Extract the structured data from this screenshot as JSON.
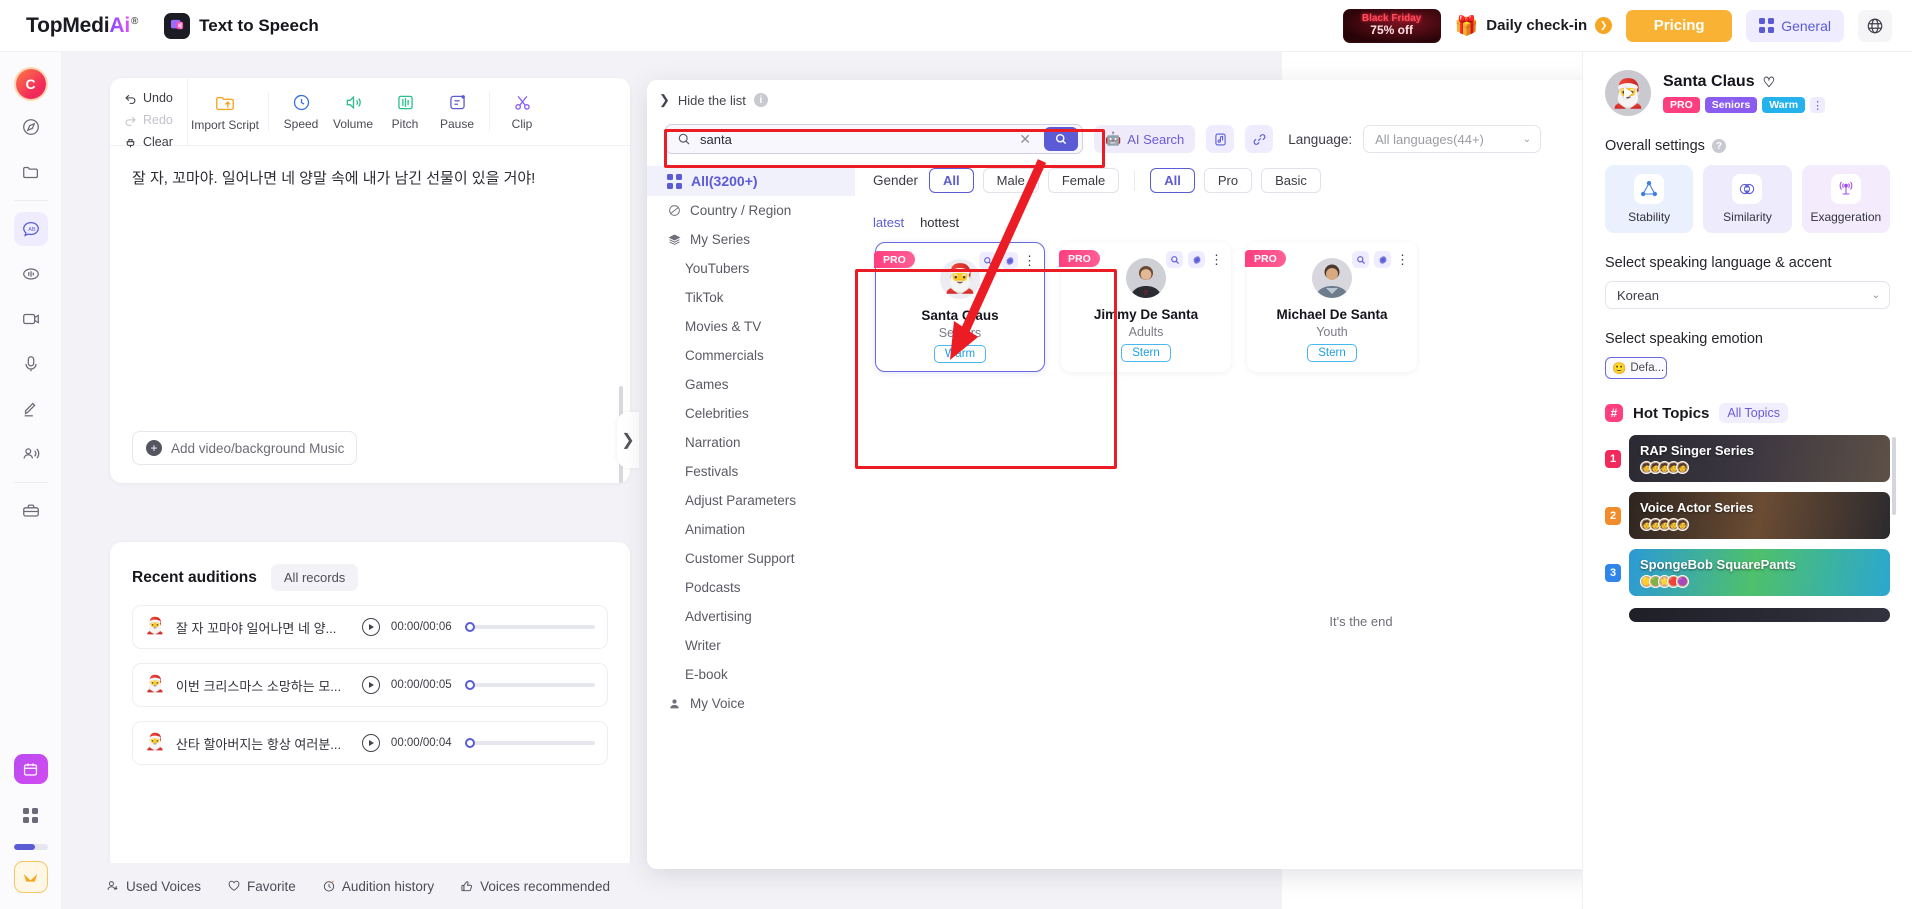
{
  "topbar": {
    "brand_main": "TopMedi",
    "brand_ai": "Ai",
    "brand_reg": "®",
    "app_title": "Text to Speech",
    "black_friday_line1": "Black Friday",
    "black_friday_line2": "75% off",
    "checkin_label": "Daily check-in",
    "pricing_label": "Pricing",
    "general_label": "General"
  },
  "toolbar": {
    "undo": "Undo",
    "redo": "Redo",
    "clear": "Clear",
    "import_script": "Import Script",
    "speed": "Speed",
    "volume": "Volume",
    "pitch": "Pitch",
    "pause": "Pause",
    "clip": "Clip"
  },
  "editor": {
    "script_text": "잘 자, 꼬마야. 일어나면 네 양말 속에 내가 남긴 선물이 있을 거야!",
    "add_media_label": "Add video/background Music"
  },
  "auditions": {
    "title": "Recent auditions",
    "all_records": "All records",
    "items": [
      {
        "name": "잘 자 꼬마야 일어나면 네 양...",
        "time": "00:00/00:06"
      },
      {
        "name": "이번 크리스마스 소망하는 모...",
        "time": "00:00/00:05"
      },
      {
        "name": "산타 할아버지는 항상 여러분...",
        "time": "00:00/00:04"
      }
    ]
  },
  "footer_tabs": [
    {
      "label": "Used Voices",
      "icon": "used-voices-icon"
    },
    {
      "label": "Favorite",
      "icon": "heart-icon"
    },
    {
      "label": "Audition history",
      "icon": "clock-icon"
    },
    {
      "label": "Voices recommended",
      "icon": "thumbs-up-icon"
    }
  ],
  "library": {
    "hide_list": "Hide the list",
    "search_value": "santa",
    "ai_search": "AI Search",
    "language_label": "Language:",
    "language_value": "All languages(44+)",
    "categories_all": "All(3200+)",
    "categories": [
      {
        "label": "Country / Region",
        "icon": "globe-icon",
        "sub": false
      },
      {
        "label": "My Series",
        "icon": "layers-icon",
        "sub": false
      },
      {
        "label": "YouTubers",
        "icon": "",
        "sub": true
      },
      {
        "label": "TikTok",
        "icon": "",
        "sub": true
      },
      {
        "label": "Movies & TV",
        "icon": "",
        "sub": true
      },
      {
        "label": "Commercials",
        "icon": "",
        "sub": true
      },
      {
        "label": "Games",
        "icon": "",
        "sub": true
      },
      {
        "label": "Celebrities",
        "icon": "",
        "sub": true
      },
      {
        "label": "Narration",
        "icon": "",
        "sub": true
      },
      {
        "label": "Festivals",
        "icon": "",
        "sub": true
      },
      {
        "label": "Adjust Parameters",
        "icon": "",
        "sub": true
      },
      {
        "label": "Animation",
        "icon": "",
        "sub": true
      },
      {
        "label": "Customer Support",
        "icon": "",
        "sub": true
      },
      {
        "label": "Podcasts",
        "icon": "",
        "sub": true
      },
      {
        "label": "Advertising",
        "icon": "",
        "sub": true
      },
      {
        "label": "Writer",
        "icon": "",
        "sub": true
      },
      {
        "label": "E-book",
        "icon": "",
        "sub": true
      },
      {
        "label": "My Voice",
        "icon": "user-icon",
        "sub": false
      }
    ],
    "gender_label": "Gender",
    "gender_options": [
      "All",
      "Male",
      "Female"
    ],
    "gender_selected": "All",
    "plan_options": [
      "All",
      "Pro",
      "Basic"
    ],
    "plan_selected": "All",
    "sorts": [
      "latest",
      "hottest"
    ],
    "sort_selected": "latest",
    "end_note": "It's the end",
    "cards": [
      {
        "badge": "PRO",
        "name": "Santa Claus",
        "age": "Seniors",
        "tag": "Warm",
        "selected": true,
        "avatar": "santa"
      },
      {
        "badge": "PRO",
        "name": "Jimmy De Santa",
        "age": "Adults",
        "tag": "Stern",
        "selected": false,
        "avatar": "man1"
      },
      {
        "badge": "PRO",
        "name": "Michael De Santa",
        "age": "Youth",
        "tag": "Stern",
        "selected": false,
        "avatar": "man2"
      }
    ]
  },
  "right_panel": {
    "voice_name": "Santa Claus",
    "tags": [
      "PRO",
      "Seniors",
      "Warm"
    ],
    "overall_settings": "Overall settings",
    "settings": [
      {
        "label": "Stability",
        "icon": "triangle-nodes-icon"
      },
      {
        "label": "Similarity",
        "icon": "similarity-icon"
      },
      {
        "label": "Exaggeration",
        "icon": "broadcast-icon"
      }
    ],
    "language_heading": "Select speaking language & accent",
    "language_value": "Korean",
    "emotion_heading": "Select speaking emotion",
    "emotion_value": "Defa...",
    "hot_topics_title": "Hot Topics",
    "all_topics": "All Topics",
    "topics": [
      {
        "rank": "1",
        "name": "RAP Singer Series"
      },
      {
        "rank": "2",
        "name": "Voice Actor Series"
      },
      {
        "rank": "3",
        "name": "SpongeBob SquarePants"
      }
    ]
  }
}
